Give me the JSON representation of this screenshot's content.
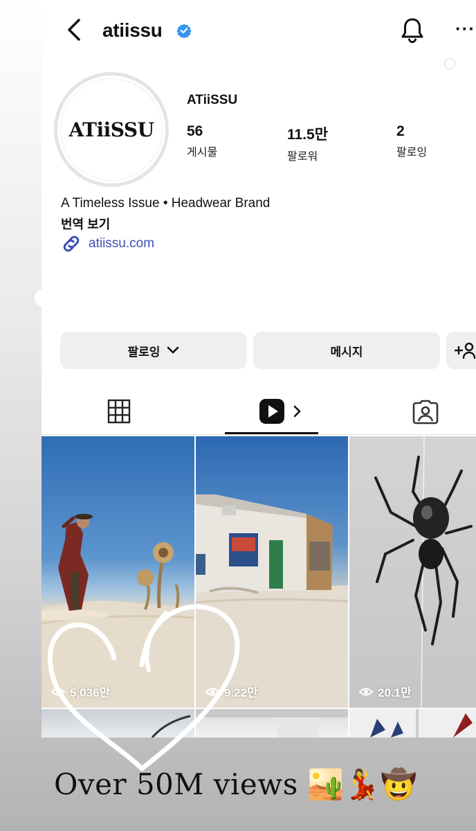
{
  "header": {
    "username": "atiissu",
    "verified_color": "#3897f0",
    "icons": [
      "back-icon",
      "verified-badge-icon",
      "bell-icon",
      "more-icon"
    ],
    "more_label": "···"
  },
  "profile": {
    "avatar_text": "ATiiSSU",
    "display_name": "ATiiSSU",
    "stats": [
      {
        "value": "56",
        "label": "게시물"
      },
      {
        "value": "11.5만",
        "label": "팔로워"
      },
      {
        "value": "2",
        "label": "팔로잉"
      }
    ],
    "bio": "A Timeless Issue • Headwear Brand",
    "translate": "번역 보기",
    "link": "atiissu.com",
    "link_color": "#3b4fb8"
  },
  "actions": {
    "following": "팔로잉",
    "message": "메시지",
    "add_user_icon": "add-user-icon"
  },
  "tabs": {
    "items": [
      "grid-icon",
      "reels-icon",
      "tagged-icon"
    ],
    "active": "reels"
  },
  "reels": [
    {
      "views": "5,036만"
    },
    {
      "views": "9.22만"
    },
    {
      "views": "20.1만"
    }
  ],
  "caption": {
    "text": "Over 50M views",
    "emoji": "🏜️💃🤠"
  }
}
